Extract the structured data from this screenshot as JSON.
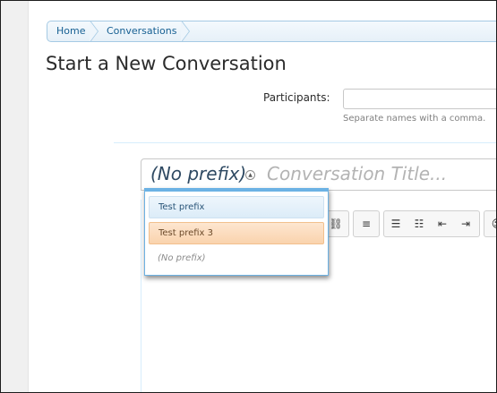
{
  "breadcrumb": {
    "home": "Home",
    "conversations": "Conversations"
  },
  "page": {
    "title": "Start a New Conversation"
  },
  "participants": {
    "label": "Participants:",
    "value": "",
    "hint": "Separate names with a comma."
  },
  "title_field": {
    "prefix": "(No prefix)",
    "placeholder": "Conversation Title..."
  },
  "prefix_menu": {
    "options": [
      {
        "label": "Test prefix",
        "style": "blue"
      },
      {
        "label": "Test prefix 3",
        "style": "orange"
      },
      {
        "label": "(No prefix)",
        "style": "none"
      }
    ]
  },
  "toolbar": {
    "icons": [
      "unlink-icon",
      "align-left-icon",
      "bullet-list-icon",
      "numbered-list-icon",
      "outdent-icon",
      "indent-icon",
      "smiley-icon"
    ]
  },
  "colors": {
    "accent": "#6cb2e4",
    "breadcrumb_border": "#a5cae4",
    "link": "#176093",
    "option_blue_bg": "#dcecf8",
    "option_orange_bg": "#fad3ad"
  }
}
